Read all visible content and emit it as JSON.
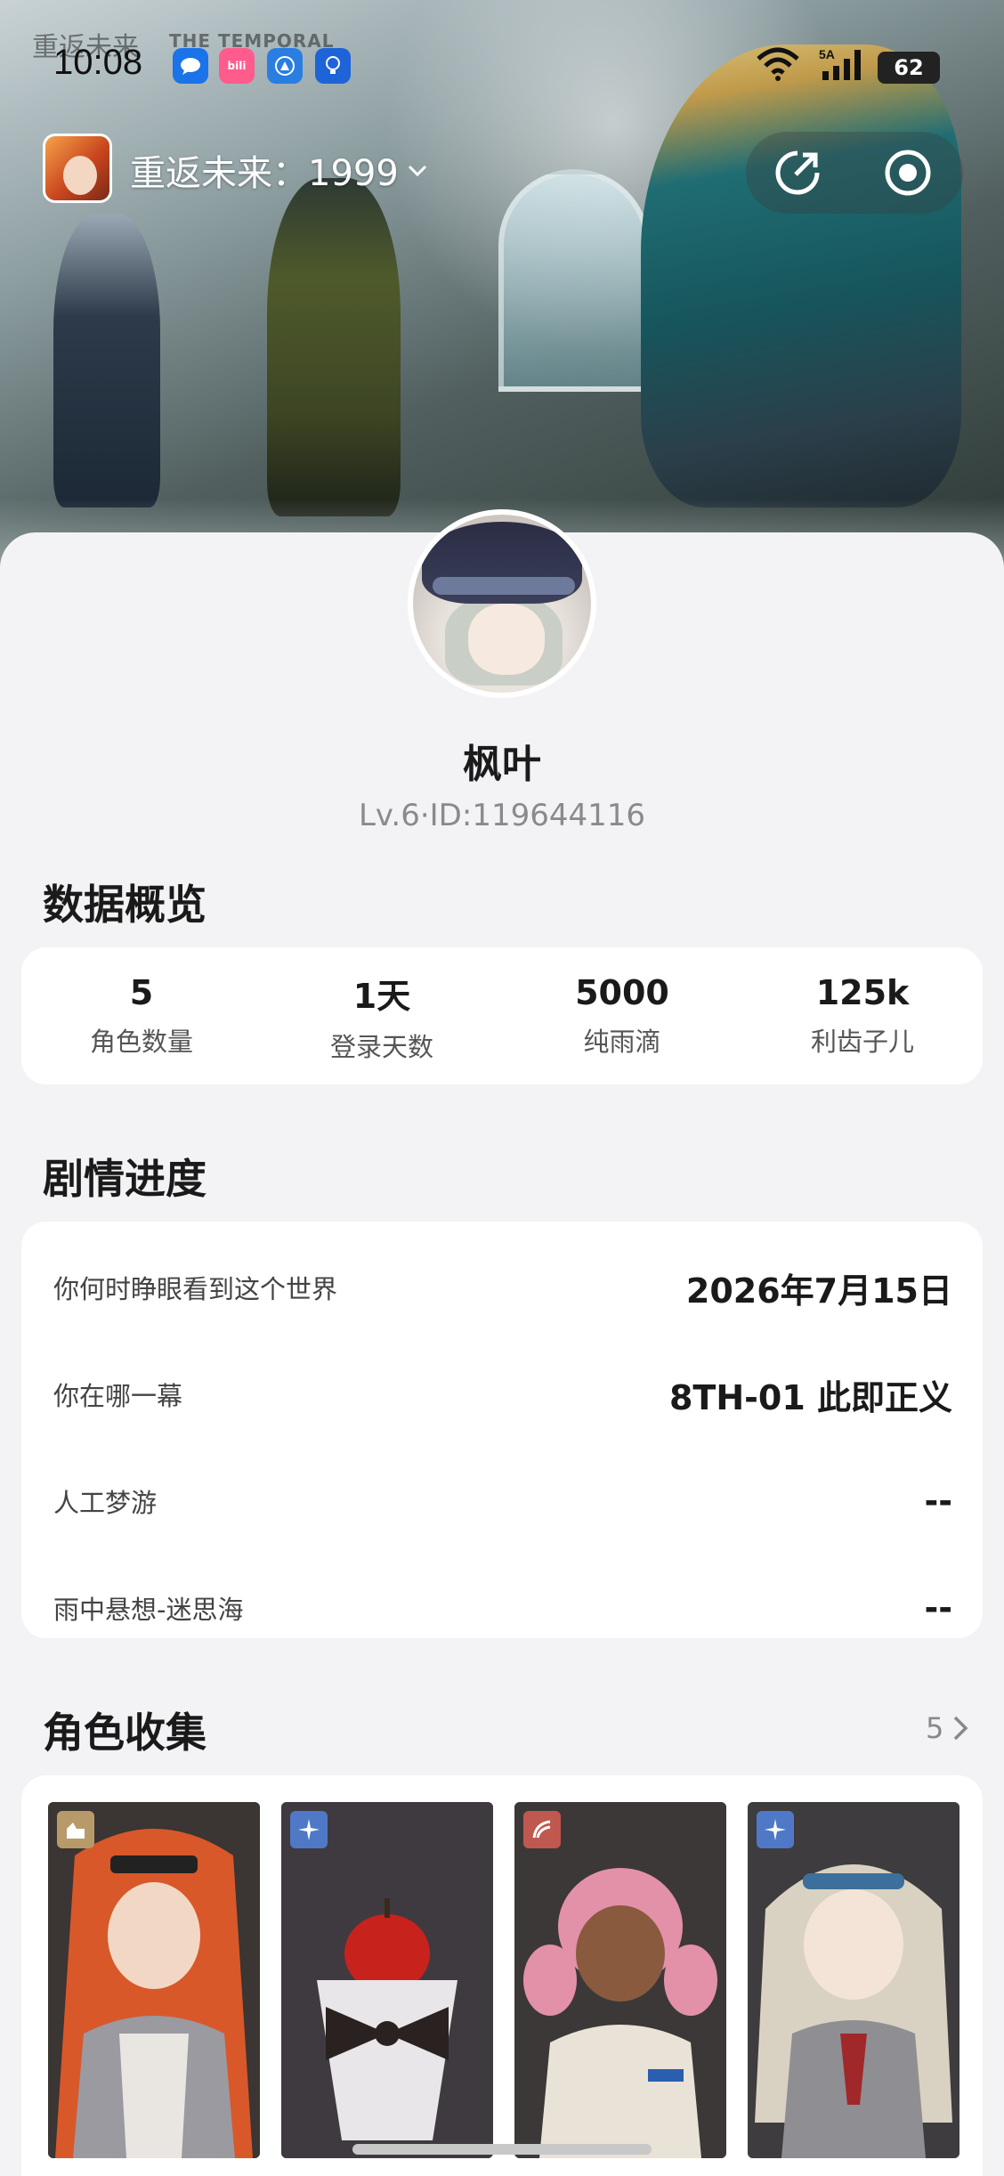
{
  "status_bar": {
    "time": "10:08",
    "battery": "62",
    "network": "5A"
  },
  "hero": {
    "watermark": "重返未来",
    "watermark_en": "THE TEMPORAL"
  },
  "header": {
    "game_title": "重返未来：1999",
    "share_icon": "share-out-icon",
    "record_icon": "record-icon"
  },
  "profile": {
    "name": "枫叶",
    "id_line": "Lv.6·ID:119644116"
  },
  "overview": {
    "title": "数据概览",
    "stats": [
      {
        "value": "5",
        "label": "角色数量"
      },
      {
        "value": "1天",
        "label": "登录天数"
      },
      {
        "value": "5000",
        "label": "纯雨滴"
      },
      {
        "value": "125k",
        "label": "利齿子儿"
      }
    ]
  },
  "story": {
    "title": "剧情进度",
    "rows": [
      {
        "key": "你何时睁眼看到这个世界",
        "value": "2026年7月15日"
      },
      {
        "key": "你在哪一幕",
        "value": "8TH-01 此即正义"
      },
      {
        "key": "人工梦游",
        "value": "--"
      },
      {
        "key": "雨中悬想-迷思海",
        "value": "--"
      }
    ]
  },
  "collection": {
    "title": "角色收集",
    "count": "5",
    "characters": [
      {
        "afflatus_icon": "beast-icon",
        "badge_color": "#b89a6a"
      },
      {
        "afflatus_icon": "star-icon",
        "badge_color": "#4f79c6"
      },
      {
        "afflatus_icon": "plant-icon",
        "badge_color": "#c0584f"
      },
      {
        "afflatus_icon": "star-icon",
        "badge_color": "#4f79c6"
      }
    ]
  },
  "colors": {
    "background": "#f3f3f6",
    "card": "#ffffff",
    "text_primary": "#1a1a1a",
    "text_secondary": "#888888"
  }
}
